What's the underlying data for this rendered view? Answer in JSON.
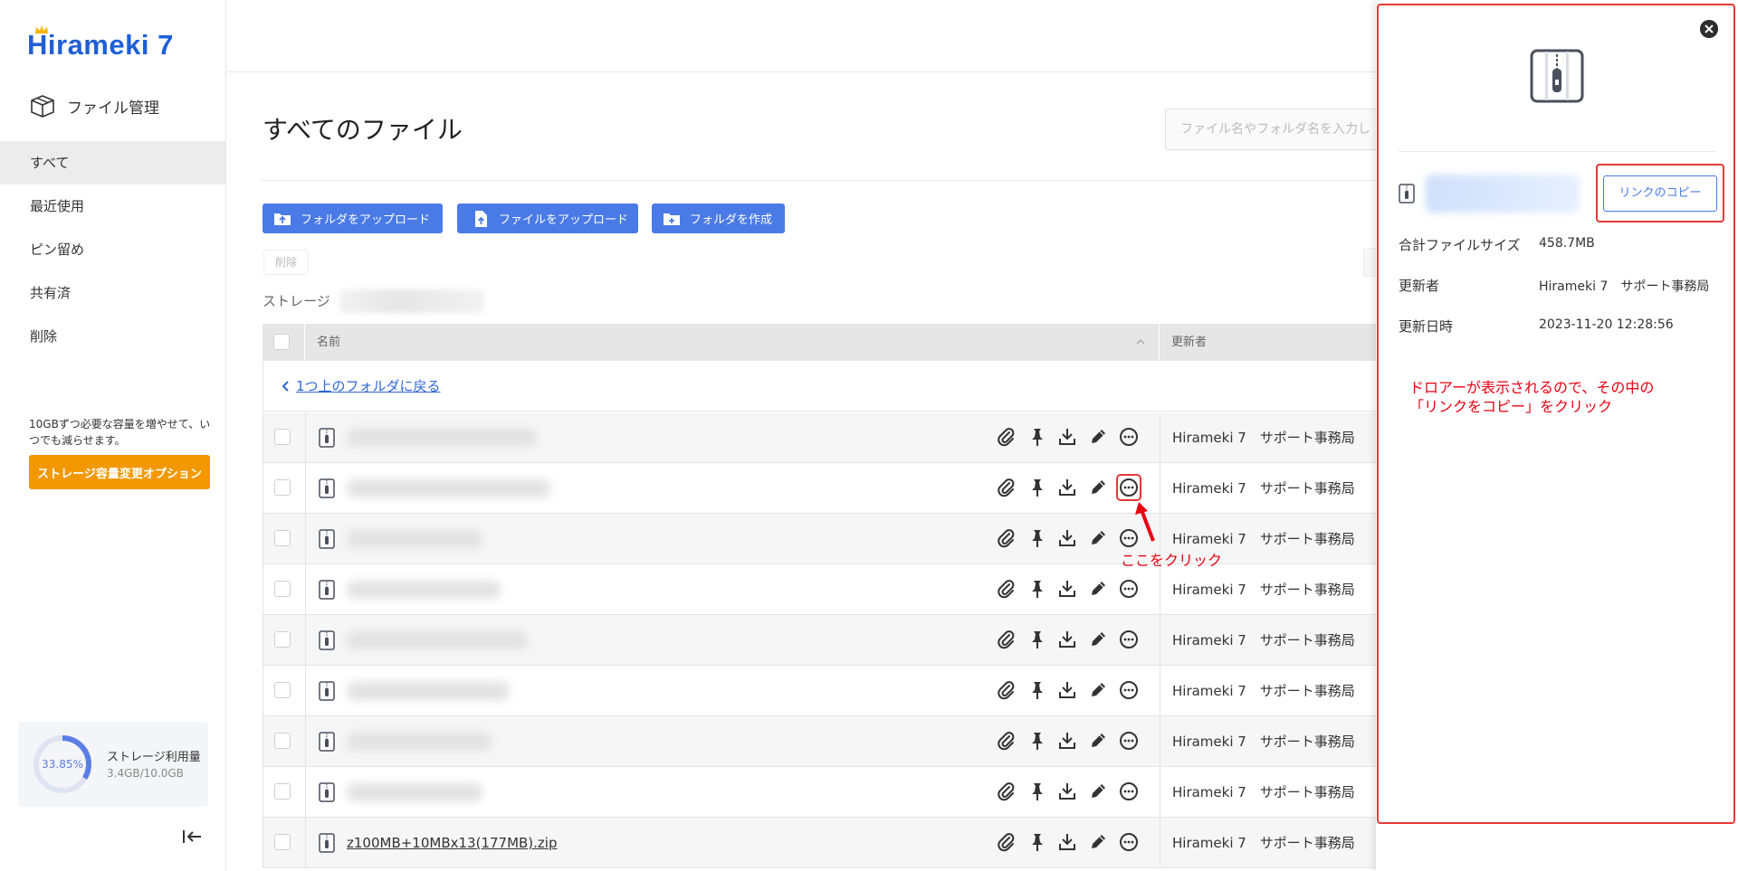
{
  "app": {
    "logo": "Hirameki 7"
  },
  "sidebar": {
    "section_title": "ファイル管理",
    "items": [
      {
        "label": "すべて",
        "active": true
      },
      {
        "label": "最近使用"
      },
      {
        "label": "ピン留め"
      },
      {
        "label": "共有済"
      },
      {
        "label": "削除"
      }
    ],
    "storage_note": "10GBずつ必要な容量を増やせて、いつでも減らせます。",
    "storage_option_button": "ストレージ容量変更オプション",
    "usage": {
      "percent_label": "33.85%",
      "percent": 33.85,
      "label": "ストレージ利用量",
      "value": "3.4GB/10.0GB"
    }
  },
  "main": {
    "title": "すべてのファイル",
    "search_placeholder": "ファイル名やフォルダ名を入力し",
    "buttons": {
      "upload_folder": "フォルダをアップロード",
      "upload_file": "ファイルをアップロード",
      "create_folder": "フォルダを作成"
    },
    "delete_label": "削除",
    "storage_label": "ストレージ",
    "table": {
      "col_name": "名前",
      "col_updater": "更新者",
      "back_link": "1つ上のフォルダに戻る",
      "rows": [
        {
          "name": "",
          "updater": "Hirameki 7　サポート事務局"
        },
        {
          "name": "",
          "updater": "Hirameki 7　サポート事務局"
        },
        {
          "name": "",
          "updater": "Hirameki 7　サポート事務局"
        },
        {
          "name": "",
          "updater": "Hirameki 7　サポート事務局"
        },
        {
          "name": "",
          "updater": "Hirameki 7　サポート事務局"
        },
        {
          "name": "",
          "updater": "Hirameki 7　サポート事務局"
        },
        {
          "name": "",
          "updater": "Hirameki 7　サポート事務局"
        },
        {
          "name": "",
          "updater": "Hirameki 7　サポート事務局"
        },
        {
          "name": "z100MB+10MBx13(177MB).zip",
          "updater": "Hirameki 7　サポート事務局"
        }
      ]
    },
    "annotation_click": "ここをクリック"
  },
  "drawer": {
    "copy_link_button": "リンクのコピー",
    "total_size_label": "合計ファイルサイズ",
    "total_size_value": "458.7MB",
    "updater_label": "更新者",
    "updater_value": "Hirameki 7　サポート事務局",
    "updated_at_label": "更新日時",
    "updated_at_value": "2023-11-20 12:28:56",
    "annotation_line1": "ドロアーが表示されるので、その中の",
    "annotation_line2": "「リンクをコピー」をクリック"
  },
  "colors": {
    "primary": "#4a7ae6",
    "accent_orange": "#f39800",
    "annotation_red": "#e60012",
    "logo_blue": "#1f5fd6"
  }
}
